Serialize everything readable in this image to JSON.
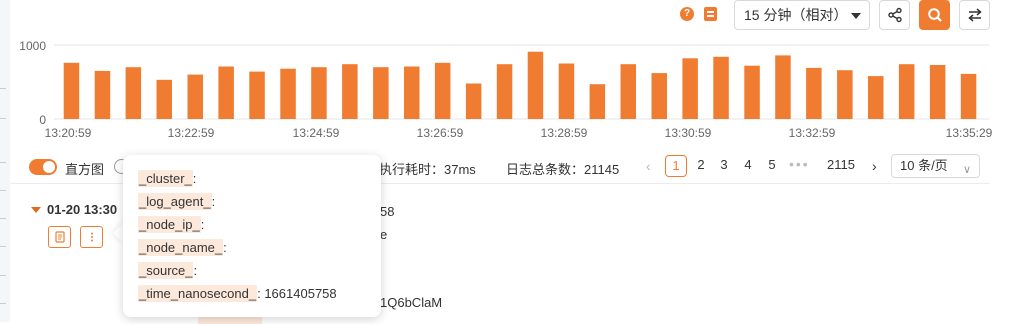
{
  "toolbar": {
    "help_icon": "?",
    "time_range": "15 分钟（相对）",
    "icons": [
      "share-icon",
      "search-icon",
      "swap-icon"
    ],
    "accent": "#f07c32"
  },
  "chart_data": {
    "type": "bar",
    "yticks": [
      "1000",
      "0"
    ],
    "ylim": [
      0,
      1000
    ],
    "xticks": [
      "13:20:59",
      "13:22:59",
      "13:24:59",
      "13:26:59",
      "13:28:59",
      "13:30:59",
      "13:32:59",
      "13:35:29"
    ],
    "values": [
      760,
      650,
      700,
      530,
      600,
      710,
      640,
      680,
      700,
      740,
      700,
      710,
      760,
      480,
      740,
      910,
      750,
      470,
      740,
      620,
      820,
      840,
      720,
      860,
      690,
      660,
      580,
      740,
      730,
      610
    ],
    "color": "#f07c32",
    "grid": true
  },
  "controls": {
    "histogram_label": "直方图",
    "exec_time": "执行耗时：37ms",
    "total": "日志总条数：21145",
    "prev": "‹",
    "pages": [
      "1",
      "2",
      "3",
      "4",
      "5"
    ],
    "active_page": "1",
    "ellipsis": "•••",
    "last_page": "2115",
    "next": "›",
    "page_size": "10 条/页"
  },
  "log_row": {
    "time": "01-20 13:30",
    "partial_values": [
      "58",
      "e",
      "1Q6bClaM"
    ]
  },
  "popup": {
    "fields": [
      {
        "key": "_cluster_",
        "value": ""
      },
      {
        "key": "_log_agent_",
        "value": ""
      },
      {
        "key": "_node_ip_",
        "value": ""
      },
      {
        "key": "_node_name_",
        "value": ""
      },
      {
        "key": "_source_",
        "value": ""
      },
      {
        "key": "_time_nanosecond_",
        "value": "1661405758"
      }
    ]
  }
}
